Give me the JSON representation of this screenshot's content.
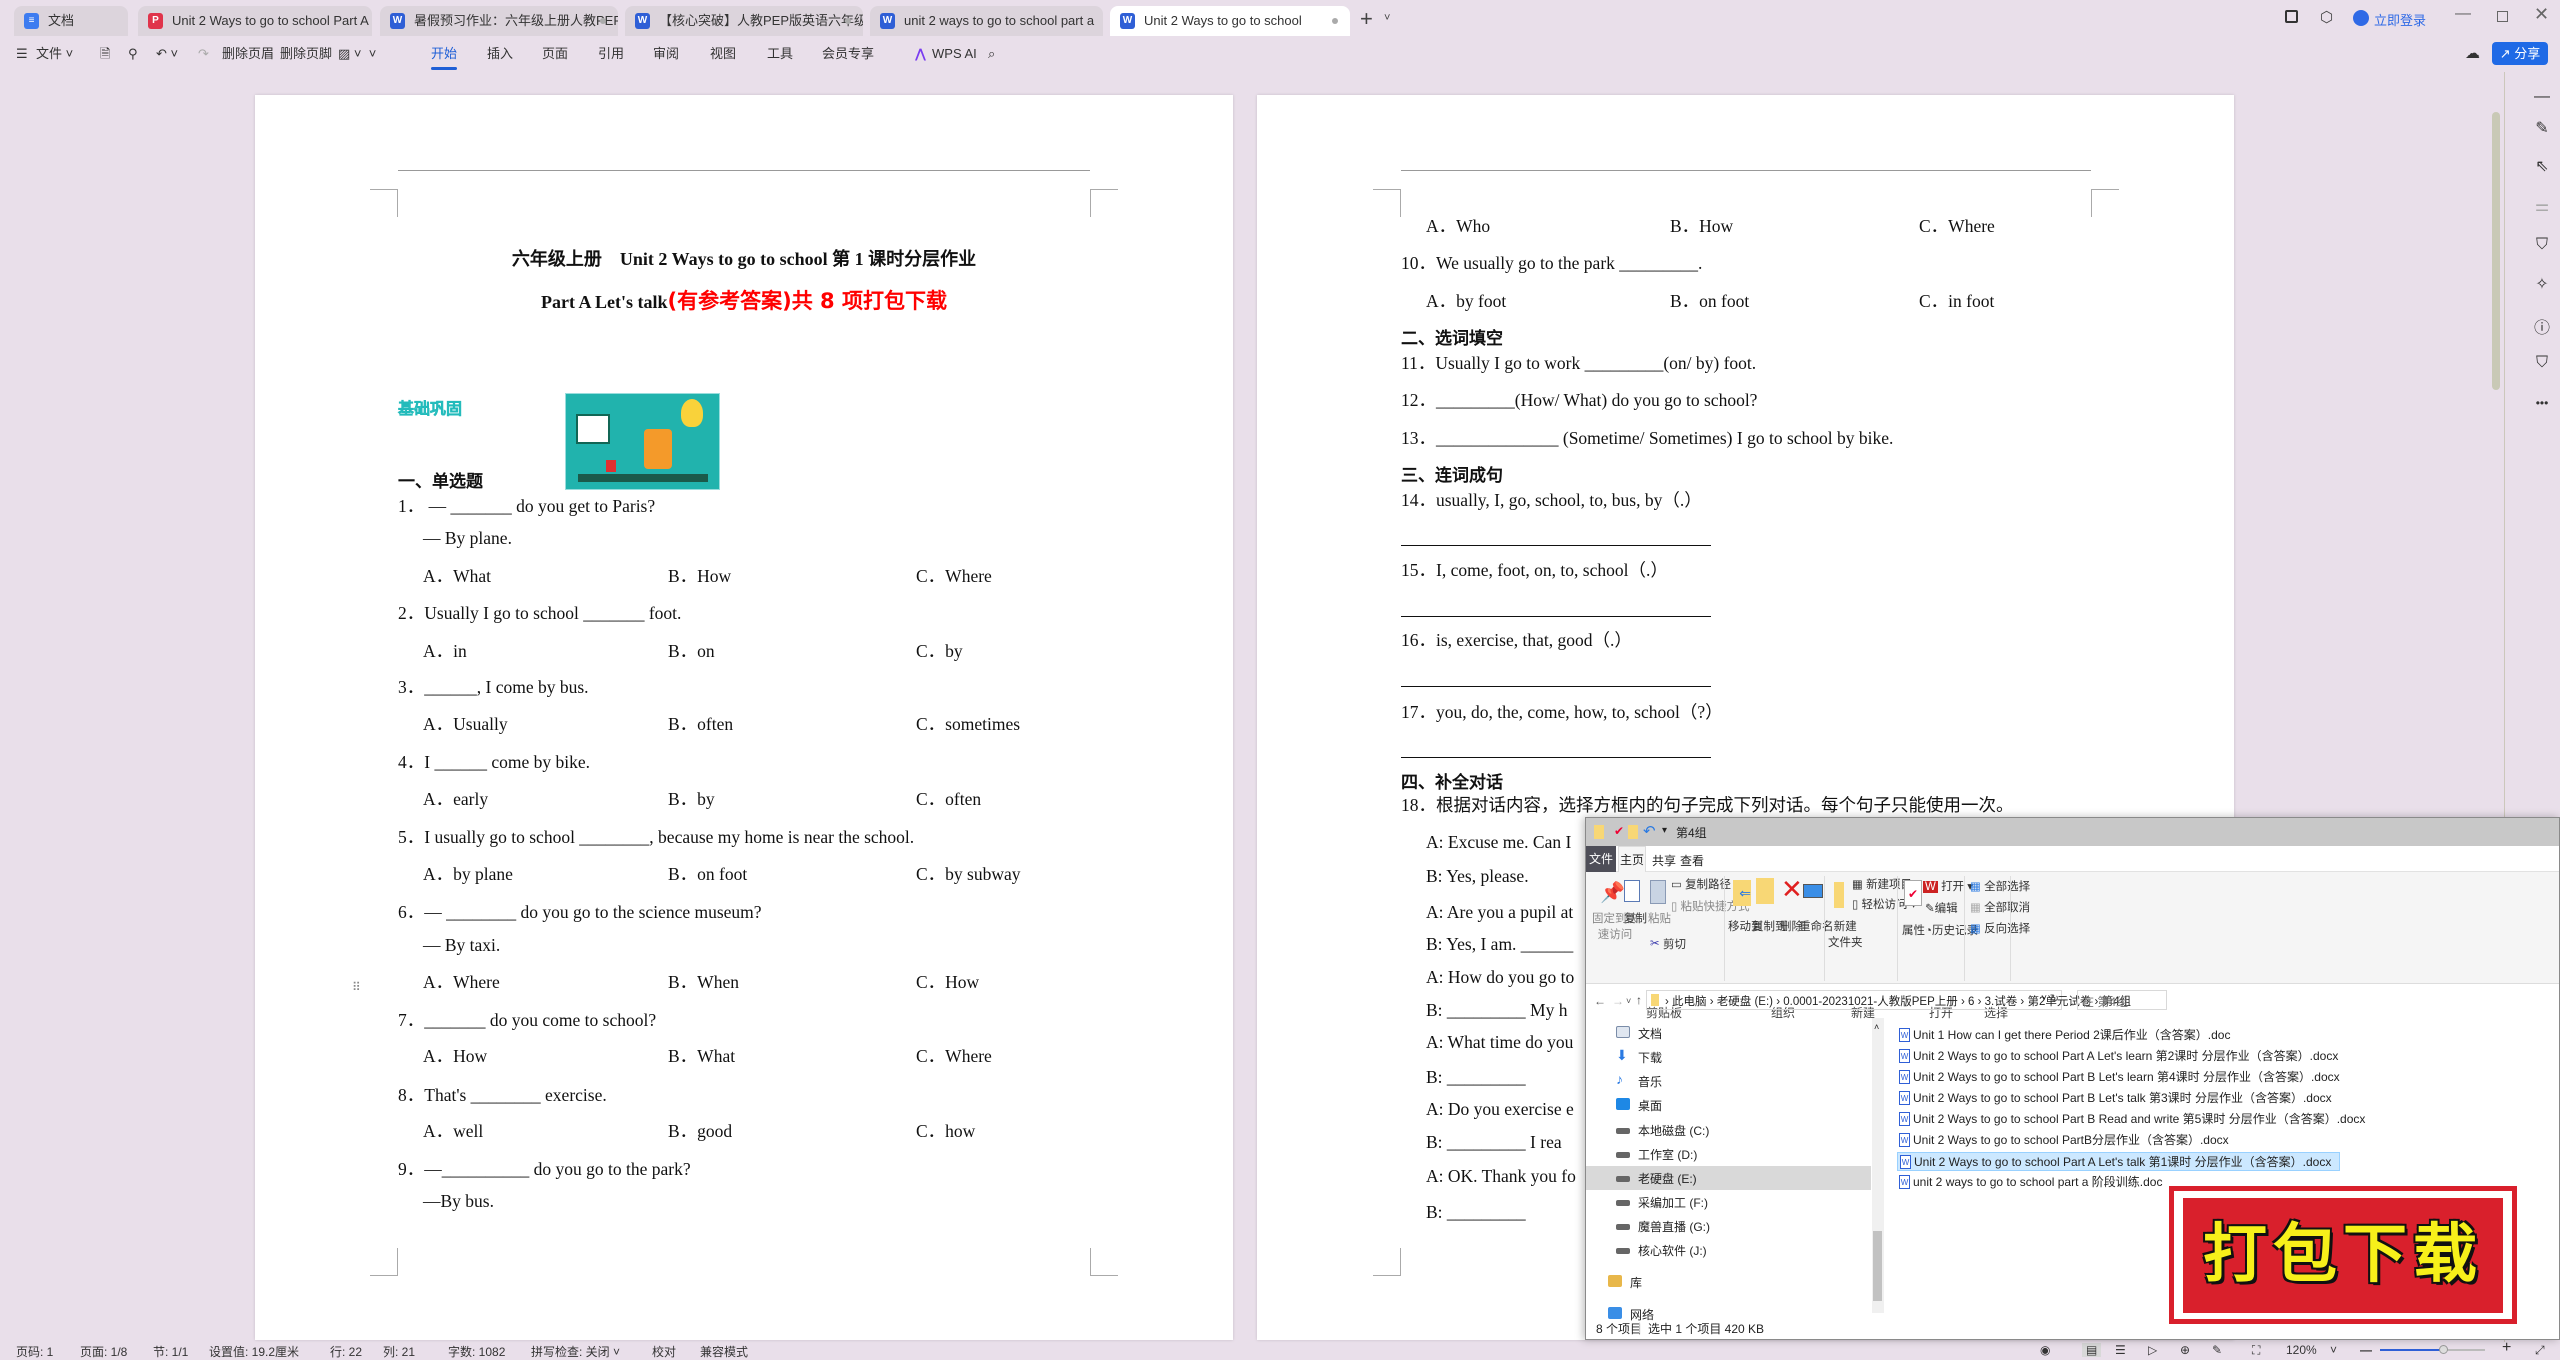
{
  "tabs": [
    {
      "label": "文档",
      "icon": "doc-icon"
    },
    {
      "label": "Unit 2 Ways to go to school Part A",
      "icon": "pdf-icon"
    },
    {
      "label": "暑假预习作业：六年级上册人教PEP",
      "icon": "word-icon"
    },
    {
      "label": "【核心突破】人教PEP版英语六年级",
      "icon": "word-icon"
    },
    {
      "label": "unit 2 ways to go to school part a",
      "icon": "word-icon"
    },
    {
      "label": "Unit 2 Ways to go to school",
      "icon": "word-icon",
      "active": true
    }
  ],
  "titlebar": {
    "login": "立即登录",
    "share": "分享"
  },
  "toolbar": {
    "menu": "文件",
    "del_header": "删除页眉",
    "del_footer": "删除页脚",
    "tabs": [
      "开始",
      "插入",
      "页面",
      "引用",
      "审阅",
      "视图",
      "工具",
      "会员专享"
    ],
    "active_tab": "开始",
    "ai": "WPS AI"
  },
  "page1": {
    "title": "六年级上册　Unit 2 Ways to go to school  第 1 课时分层作业",
    "subtitle_black": "Part A Let's talk",
    "subtitle_red": "(有参考答案)共 8 项打包下载",
    "badge": "基础巩固",
    "section1": "一、单选题",
    "questions": [
      {
        "q": "1． — _______ do you get to Paris?",
        "q2": "— By plane.",
        "a": "A．What",
        "b": "B．How",
        "c": "C．Where"
      },
      {
        "q": "2．Usually I go to school _______ foot.",
        "a": "A．in",
        "b": "B．on",
        "c": "C．by"
      },
      {
        "q": "3．______, I come by bus.",
        "a": "A．Usually",
        "b": "B．often",
        "c": "C．sometimes"
      },
      {
        "q": "4．I ______ come by bike.",
        "a": "A．early",
        "b": "B．by",
        "c": "C．often"
      },
      {
        "q": "5．I usually go to school ________, because my home is near the school.",
        "a": "A．by plane",
        "b": "B．on foot",
        "c": "C．by subway"
      },
      {
        "q": "6．— ________ do you go to the science museum?",
        "q2": "— By taxi.",
        "a": "A．Where",
        "b": "B．When",
        "c": "C．How"
      },
      {
        "q": "7．_______ do you come to school?",
        "a": "A．How",
        "b": "B．What",
        "c": "C．Where"
      },
      {
        "q": "8．That's ________ exercise.",
        "a": "A．well",
        "b": "B．good",
        "c": "C．how"
      },
      {
        "q": "9．—__________ do you go to the park?",
        "q2": "—By bus."
      }
    ]
  },
  "page2": {
    "q9_opts": {
      "a": "A．Who",
      "b": "B．How",
      "c": "C．Where"
    },
    "q10": {
      "q": "10．We usually go to the park _________.",
      "a": "A．by foot",
      "b": "B．on foot",
      "c": "C．in foot"
    },
    "section2": "二、选词填空",
    "q11": "11．Usually I go to work  _________(on/ by) foot.",
    "q12": "12．_________(How/ What) do you go to school?",
    "q13": "13．______________  (Sometime/ Sometimes) I go to school by bike.",
    "section3": "三、连词成句",
    "q14": "14．usually, I, go, school, to, bus, by（.）",
    "q15": "15．I, come, foot, on, to, school（.）",
    "q16": "16．is, exercise, that, good（.）",
    "q17": "17．you, do, the, come, how, to, school（?）",
    "section4": "四、补全对话",
    "q18": "18．根据对话内容，选择方框内的句子完成下列对话。每个句子只能使用一次。",
    "dialog": [
      "A: Excuse me. Can I",
      "B: Yes, please.",
      "A: Are you a pupil at",
      "B: Yes, I am.  ______",
      "A: How do you go to",
      "B:  _________  My h",
      "A: What time do you",
      "B:  _________",
      "A: Do you exercise e",
      "B:  _________  I rea",
      "A: OK. Thank you fo",
      "B:  _________"
    ]
  },
  "statusbar": {
    "page_no": "页码: 1",
    "pages": "页面: 1/8",
    "section": "节: 1/1",
    "setting": "设置值: 19.2厘米",
    "row": "行: 22",
    "col": "列: 21",
    "words": "字数: 1082",
    "spell": "拼写检查: 关闭",
    "proof": "校对",
    "compat": "兼容模式",
    "zoom": "120%",
    "zoom_level": 0.6
  },
  "explorer": {
    "title": "第4组",
    "ribbon_tabs": [
      "文件",
      "主页",
      "共享",
      "查看"
    ],
    "active_tab": "主页",
    "ribbon": {
      "pin": "固定到快\n速访问",
      "copy": "复制",
      "paste": "粘贴",
      "copy_path": "复制路径",
      "paste_shortcut": "粘贴快捷方式",
      "cut": "剪切",
      "clipboard": "剪贴板",
      "move_to": "移动到",
      "copy_to": "复制到",
      "delete": "删除",
      "rename": "重命名",
      "organize": "组织",
      "new_folder": "新建\n文件夹",
      "new_item": "新建项目",
      "easy_access": "轻松访问",
      "new": "新建",
      "properties": "属性",
      "open": "打开",
      "edit": "编辑",
      "history": "历史记录",
      "open_group": "打开",
      "select_all": "全部选择",
      "select_none": "全部取消",
      "invert": "反向选择",
      "select": "选择"
    },
    "path": [
      "此电脑",
      "老硬盘 (E:)",
      "0.0001-20231021-人教版PEP上册",
      "6",
      "3.试卷",
      "第2单元试卷",
      "第4组"
    ],
    "search_placeholder": "在 第4组",
    "nav": [
      {
        "label": "文档",
        "color": "#7a8ca8"
      },
      {
        "label": "下载",
        "color": "#2a7ae2"
      },
      {
        "label": "音乐",
        "color": "#2a7ae2"
      },
      {
        "label": "桌面",
        "color": "#1e88e5"
      },
      {
        "label": "本地磁盘 (C:)",
        "color": "#555"
      },
      {
        "label": "工作室 (D:)",
        "color": "#555"
      },
      {
        "label": "老硬盘 (E:)",
        "color": "#555",
        "selected": true
      },
      {
        "label": "采编加工 (F:)",
        "color": "#555"
      },
      {
        "label": "魔兽直播 (G:)",
        "color": "#555"
      },
      {
        "label": "核心软件 (J:)",
        "color": "#555"
      },
      {
        "label": "库",
        "color": "#e8b74a"
      },
      {
        "label": "网络",
        "color": "#3a8ee6"
      }
    ],
    "files": [
      "Unit 1 How can I get there Period 2课后作业（含答案）.doc",
      "Unit 2 Ways to go to school  Part A Let's learn 第2课时 分层作业（含答案）.docx",
      "Unit 2 Ways to go to school  Part B Let's learn 第4课时 分层作业（含答案）.docx",
      "Unit 2 Ways to go to school  Part B Let's talk 第3课时 分层作业（含答案）.docx",
      "Unit 2 Ways to go to school  Part B Read and write 第5课时 分层作业（含答案）.docx",
      "Unit 2 Ways to go to school  PartB分层作业（含答案）.docx",
      "Unit 2 Ways to go to school Part A Let's talk  第1课时 分层作业（含答案）.docx",
      "unit 2 ways to go to school part a 阶段训练.doc"
    ],
    "selected_index": 6,
    "status_count": "8 个项目",
    "status_selected": "选中 1 个项目  420 KB"
  },
  "stamp": {
    "text": "打包下载",
    "bg": "#d9202c",
    "fg": "#f7f01a"
  },
  "colors": {
    "accent": "#1f5fd6",
    "canvas": "#e9dfea",
    "red": "#ff0000"
  }
}
